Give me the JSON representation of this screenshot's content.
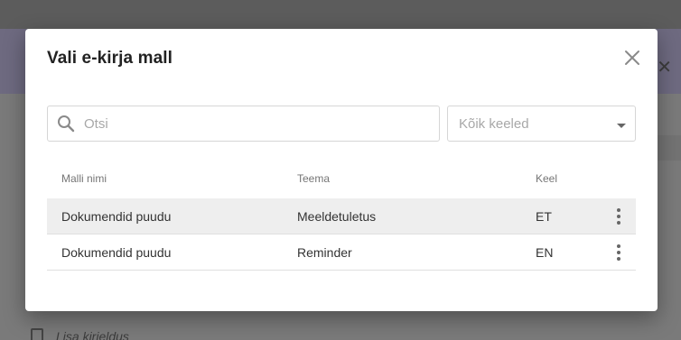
{
  "dialog": {
    "title": "Vali e-kirja mall",
    "close_icon": "close-icon"
  },
  "search": {
    "placeholder": "Otsi",
    "value": "",
    "icon": "search-icon"
  },
  "language_filter": {
    "selected": "Kõik keeled",
    "icon": "caret-down-icon"
  },
  "table": {
    "columns": [
      "Malli nimi",
      "Teema",
      "Keel"
    ],
    "rows": [
      {
        "name": "Dokumendid puudu",
        "subject": "Meeldetuletus",
        "language": "ET",
        "highlighted": true
      },
      {
        "name": "Dokumendid puudu",
        "subject": "Reminder",
        "language": "EN",
        "highlighted": false
      }
    ],
    "row_menu_icon": "more-vertical-icon",
    "highlight_color": "#eeeeee"
  },
  "background": {
    "add_description": "Lisa kirjeldus",
    "icons": [
      "close-icon",
      "document-icon"
    ]
  }
}
